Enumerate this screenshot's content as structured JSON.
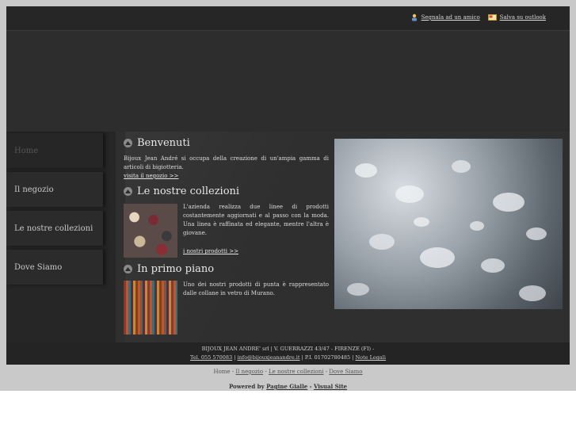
{
  "toplinks": {
    "segnala": "Segnala ad un amico",
    "salva": "Salva su outlook"
  },
  "nav": {
    "items": [
      {
        "label": "Home"
      },
      {
        "label": "Il negozio"
      },
      {
        "label": "Le nostre collezioni"
      },
      {
        "label": "Dove Siamo"
      }
    ]
  },
  "sections": {
    "benvenuti": {
      "title": "Benvenuti",
      "text": "Bijoux Jean André si occupa della creazione di un'ampia gamma di articoli di bigiotteria.",
      "link": "visita il negozio >>"
    },
    "collezioni": {
      "title": "Le nostre collezioni",
      "text": "L'azienda realizza due linee di prodotti costantemente aggiornati e al passo con la moda. Una linea è raffinata ed elegante, mentre l'altra è giovane.",
      "link": "i nostri prodotti >>"
    },
    "primopiano": {
      "title": "In primo piano",
      "text": "Uno dei nostri prodotti di punta è rappresentato dalle collane in vetro di Murano."
    }
  },
  "footer": {
    "line1": "BIJOUX JEAN ANDRE' srl | V. GUERRAZZI 43/47 - FIRENZE (FI) -",
    "tel": "Tel. 055 570083",
    "email": "info@bijouxjeanandre.it",
    "piva": "P.I. 01702780485",
    "note": "Note Legali"
  },
  "bottomnav": {
    "home": "Home",
    "negozio": "Il negozio",
    "collezioni": "Le nostre collezioni",
    "dove": "Dove Siamo"
  },
  "powered": {
    "label": "Powered by",
    "pg": "Pagine Gialle",
    "vs": "Visual Site"
  }
}
